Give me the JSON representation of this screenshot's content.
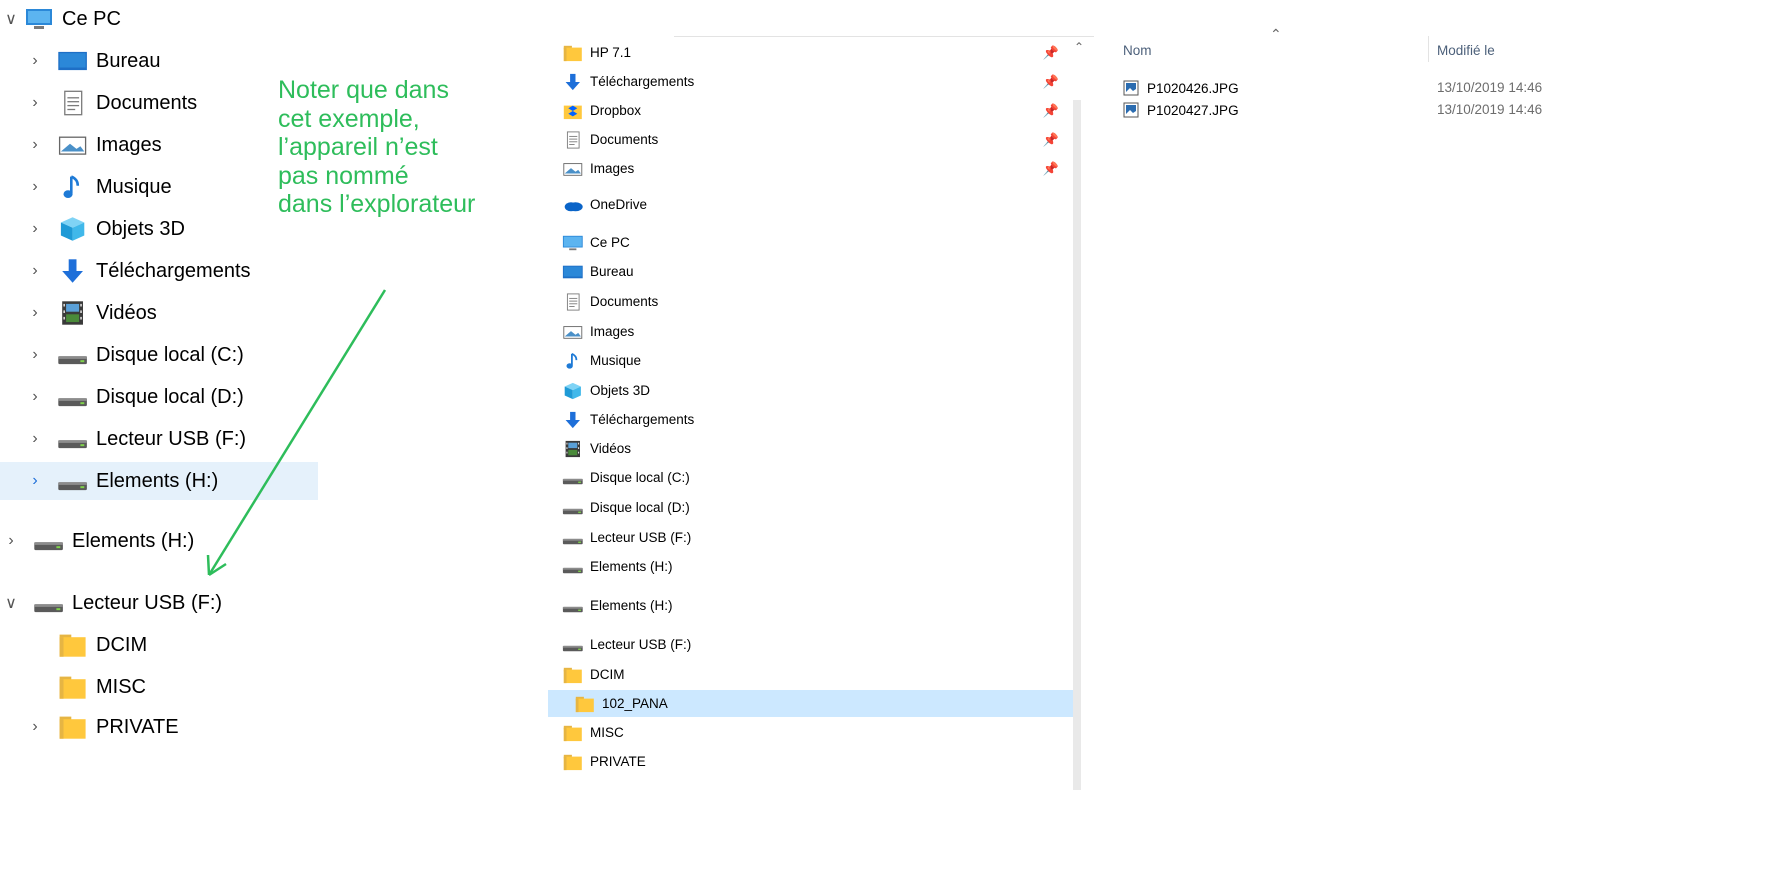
{
  "left_tree": {
    "root": "Ce PC",
    "items": [
      {
        "label": "Bureau",
        "icon": "desktop-icon"
      },
      {
        "label": "Documents",
        "icon": "documents-icon"
      },
      {
        "label": "Images",
        "icon": "images-icon"
      },
      {
        "label": "Musique",
        "icon": "music-icon"
      },
      {
        "label": "Objets 3D",
        "icon": "objects-3d-icon"
      },
      {
        "label": "Téléchargements",
        "icon": "download-icon"
      },
      {
        "label": "Vidéos",
        "icon": "videos-icon"
      },
      {
        "label": "Disque local (C:)",
        "icon": "drive-icon"
      },
      {
        "label": "Disque local (D:)",
        "icon": "drive-icon"
      },
      {
        "label": "Lecteur USB (F:)",
        "icon": "drive-icon"
      },
      {
        "label": "Elements (H:)",
        "icon": "drive-icon",
        "selected": true
      }
    ],
    "extra": [
      {
        "label": "Elements (H:)",
        "icon": "drive-icon"
      },
      {
        "label": "Lecteur USB (F:)",
        "icon": "drive-icon",
        "expanded": true
      },
      {
        "label": "DCIM",
        "icon": "folder-icon"
      },
      {
        "label": "MISC",
        "icon": "folder-icon"
      },
      {
        "label": "PRIVATE",
        "icon": "folder-icon"
      }
    ]
  },
  "annotation": {
    "lines": [
      "Noter que dans",
      "cet exemple,",
      "l’appareil n’est",
      "pas nommé",
      "dans l’explorateur"
    ],
    "color": "#2ebd5b"
  },
  "mid_tree": {
    "items": [
      {
        "label": "HP 7.1",
        "icon": "folder-icon",
        "pinned": true
      },
      {
        "label": "Téléchargements",
        "icon": "download-icon",
        "pinned": true
      },
      {
        "label": "Dropbox",
        "icon": "dropbox-icon",
        "pinned": true
      },
      {
        "label": "Documents",
        "icon": "documents-icon",
        "pinned": true
      },
      {
        "label": "Images",
        "icon": "images-icon",
        "pinned": true
      },
      {
        "label": "OneDrive",
        "icon": "onedrive-icon"
      },
      {
        "label": "Ce PC",
        "icon": "computer-icon"
      },
      {
        "label": "Bureau",
        "icon": "desktop-icon"
      },
      {
        "label": "Documents",
        "icon": "documents-icon"
      },
      {
        "label": "Images",
        "icon": "images-icon"
      },
      {
        "label": "Musique",
        "icon": "music-icon"
      },
      {
        "label": "Objets 3D",
        "icon": "objects-3d-icon"
      },
      {
        "label": "Téléchargements",
        "icon": "download-icon"
      },
      {
        "label": "Vidéos",
        "icon": "videos-icon"
      },
      {
        "label": "Disque local (C:)",
        "icon": "drive-icon"
      },
      {
        "label": "Disque local (D:)",
        "icon": "drive-icon"
      },
      {
        "label": "Lecteur USB (F:)",
        "icon": "drive-icon"
      },
      {
        "label": "Elements (H:)",
        "icon": "drive-icon"
      },
      {
        "label": "Elements (H:)",
        "icon": "drive-icon"
      },
      {
        "label": "Lecteur USB (F:)",
        "icon": "drive-icon"
      },
      {
        "label": "DCIM",
        "icon": "folder-icon"
      },
      {
        "label": "102_PANA",
        "icon": "folder-icon",
        "selected": true
      },
      {
        "label": "MISC",
        "icon": "folder-icon"
      },
      {
        "label": "PRIVATE",
        "icon": "folder-icon"
      }
    ]
  },
  "file_list": {
    "col_name": "Nom",
    "col_date": "Modifié le",
    "files": [
      {
        "name": "P1020426.JPG",
        "date": "13/10/2019 14:46"
      },
      {
        "name": "P1020427.JPG",
        "date": "13/10/2019 14:46"
      }
    ]
  }
}
